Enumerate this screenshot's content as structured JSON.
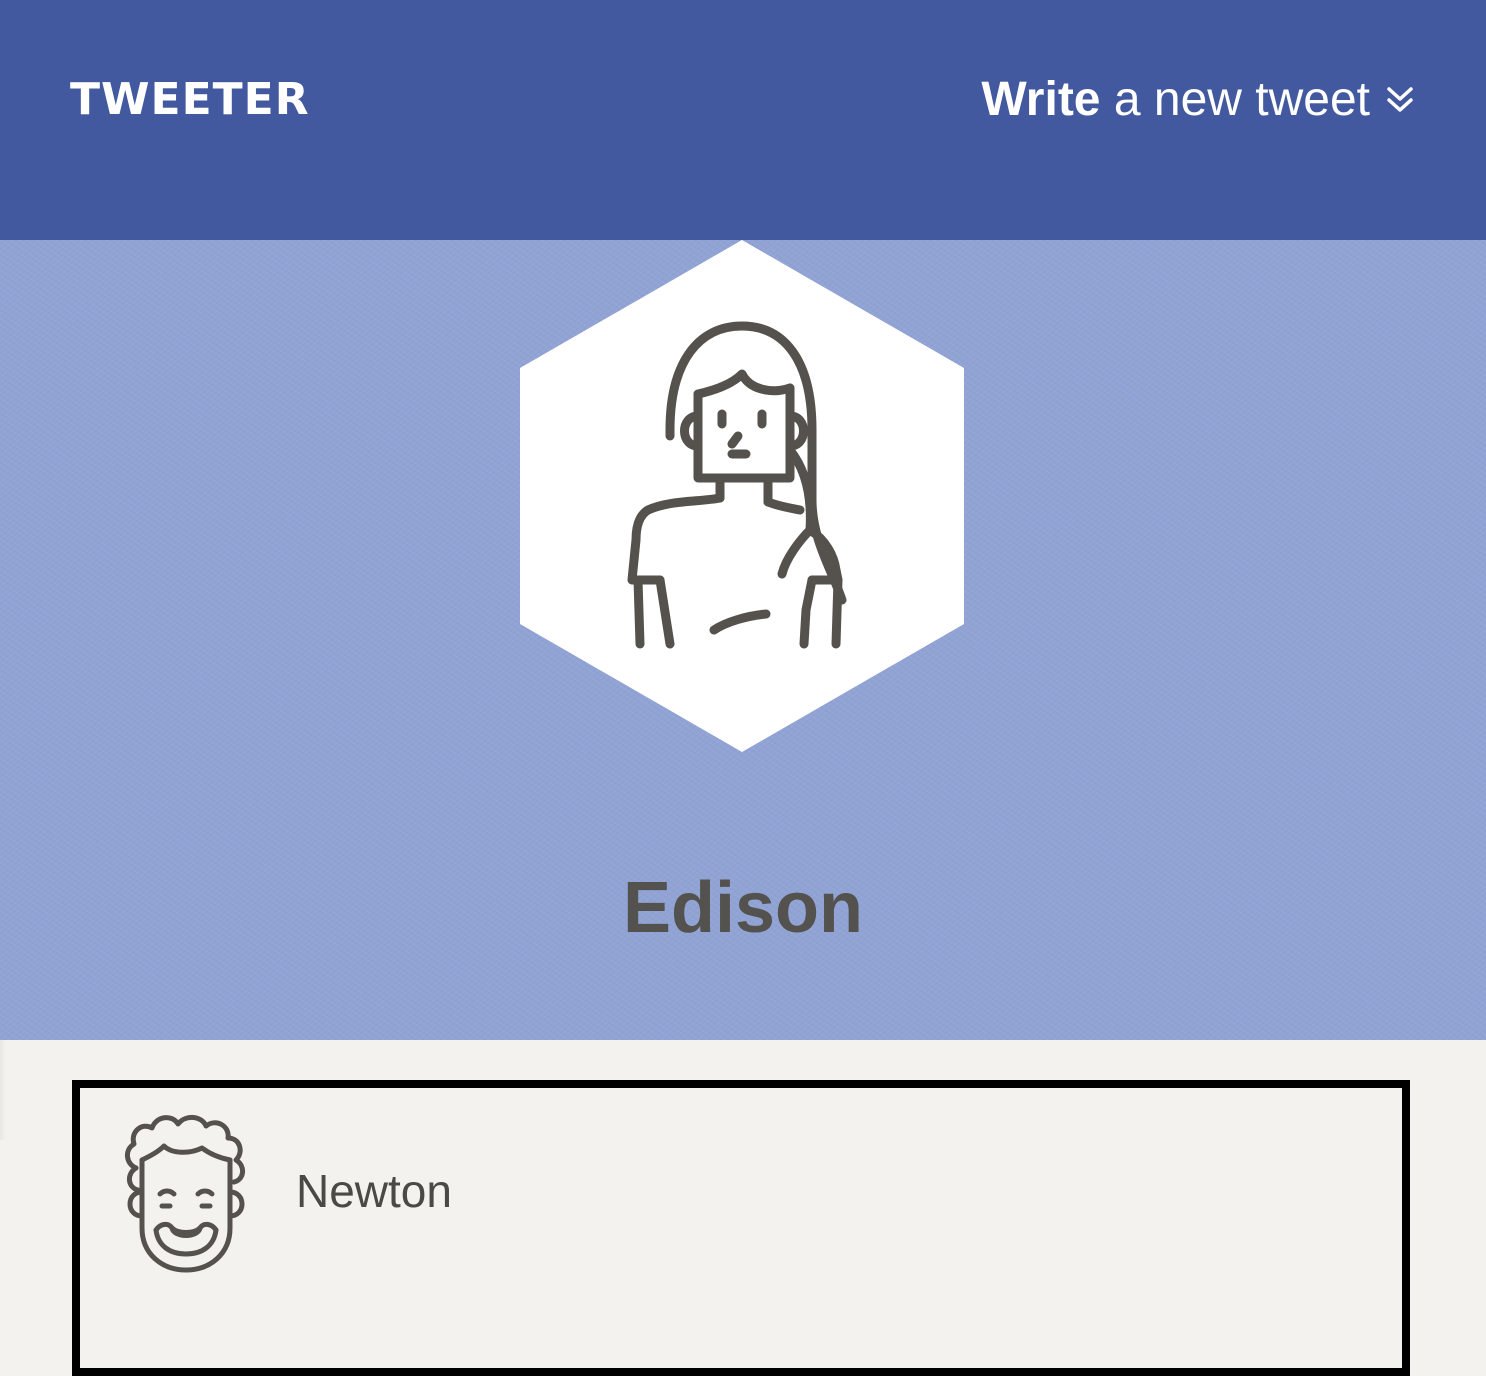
{
  "header": {
    "brand": "TWEETER",
    "compose": {
      "word_bold": "Write",
      "rest": "a new tweet",
      "icon": "double-chevron-down-icon"
    }
  },
  "profile": {
    "name": "Edison",
    "avatar_icon": "woman-avatar-icon"
  },
  "tweets": [
    {
      "author": "Newton",
      "avatar_icon": "curly-hair-man-avatar-icon"
    }
  ],
  "colors": {
    "header_bg": "#43599f",
    "hero_bg": "#90a3d4",
    "page_bg": "#f4f2ef",
    "text_dark": "#54524f",
    "card_border": "#000000"
  }
}
